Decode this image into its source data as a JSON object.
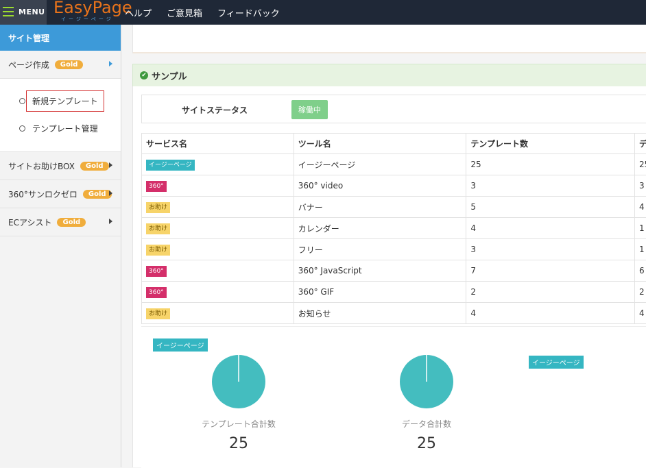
{
  "topbar": {
    "menu_label": "MENU",
    "logo_main": "EasyPage",
    "logo_sub": "イージーページ",
    "nav": [
      "ヘルプ",
      "ご意見箱",
      "フィードバック"
    ]
  },
  "sidebar": {
    "header": "サイト管理",
    "groups": [
      {
        "label": "ページ作成",
        "badge": "Gold"
      },
      {
        "label": "サイトお助けBOX",
        "badge": "Gold"
      },
      {
        "label": "360°サンロクゼロ",
        "badge": "Gold"
      },
      {
        "label": "ECアシスト",
        "badge": "Gold"
      }
    ],
    "sub_items": [
      "新規テンプレート",
      "テンプレート管理"
    ]
  },
  "panel": {
    "title": "サンプル",
    "status_label": "サイトステータス",
    "status_value": "稼働中"
  },
  "table": {
    "headers": [
      "サービス名",
      "ツール名",
      "テンプレート数",
      "デ"
    ],
    "rows": [
      {
        "tag": "イージーページ",
        "tag_type": "easy",
        "tool": "イージーページ",
        "templates": "25",
        "data": "25"
      },
      {
        "tag": "360°",
        "tag_type": "deg",
        "tool": "360° video",
        "templates": "3",
        "data": "3"
      },
      {
        "tag": "お助け",
        "tag_type": "help",
        "tool": "バナー",
        "templates": "5",
        "data": "4"
      },
      {
        "tag": "お助け",
        "tag_type": "help",
        "tool": "カレンダー",
        "templates": "4",
        "data": "1"
      },
      {
        "tag": "お助け",
        "tag_type": "help",
        "tool": "フリー",
        "templates": "3",
        "data": "1"
      },
      {
        "tag": "360°",
        "tag_type": "deg",
        "tool": "360° JavaScript",
        "templates": "7",
        "data": "6"
      },
      {
        "tag": "360°",
        "tag_type": "deg",
        "tool": "360° GIF",
        "templates": "2",
        "data": "2"
      },
      {
        "tag": "お助け",
        "tag_type": "help",
        "tool": "お知らせ",
        "templates": "4",
        "data": "4"
      }
    ]
  },
  "charts": {
    "tag1": "イージーページ",
    "tag2": "イージーページ",
    "pie1": {
      "label": "テンプレート合計数",
      "value": "25"
    },
    "pie2": {
      "label": "データ合計数",
      "value": "25"
    },
    "pie_color": "#44bdbf"
  }
}
